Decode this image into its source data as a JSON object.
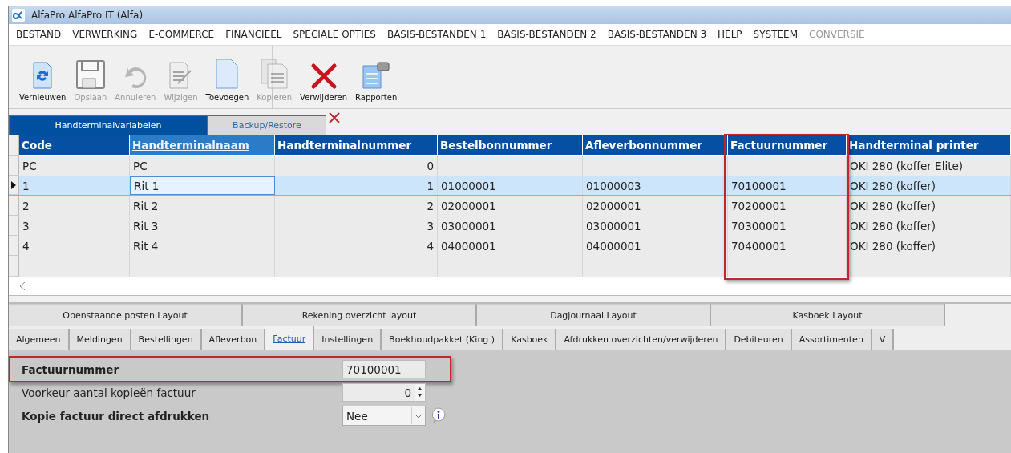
{
  "window": {
    "title": "AlfaPro AlfaPro IT (Alfa)"
  },
  "menu": [
    {
      "label": "BESTAND",
      "disabled": false
    },
    {
      "label": "VERWERKING",
      "disabled": false
    },
    {
      "label": "E-COMMERCE",
      "disabled": false
    },
    {
      "label": "FINANCIEEL",
      "disabled": false
    },
    {
      "label": "SPECIALE OPTIES",
      "disabled": false
    },
    {
      "label": "BASIS-BESTANDEN 1",
      "disabled": false
    },
    {
      "label": "BASIS-BESTANDEN 2",
      "disabled": false
    },
    {
      "label": "BASIS-BESTANDEN 3",
      "disabled": false
    },
    {
      "label": "HELP",
      "disabled": false
    },
    {
      "label": "SYSTEEM",
      "disabled": false
    },
    {
      "label": "CONVERSIE",
      "disabled": true
    }
  ],
  "toolbar": [
    {
      "kind": "refresh",
      "label": "Vernieuwen",
      "disabled": false
    },
    {
      "kind": "save",
      "label": "Opslaan",
      "disabled": true
    },
    {
      "kind": "undo",
      "label": "Annuleren",
      "disabled": true
    },
    {
      "kind": "edit",
      "label": "Wijzigen",
      "disabled": true
    },
    {
      "kind": "new",
      "label": "Toevoegen",
      "disabled": false
    },
    {
      "kind": "copy",
      "label": "Kopieren",
      "disabled": true
    },
    {
      "kind": "delete",
      "label": "Verwijderen",
      "disabled": false
    },
    {
      "kind": "report",
      "label": "Rapporten",
      "disabled": false
    }
  ],
  "tabs": [
    {
      "label": "Handterminalvariabelen",
      "selected": true
    },
    {
      "label": "Backup/Restore",
      "selected": false
    }
  ],
  "table": {
    "columns": [
      {
        "label": "Code",
        "current": false
      },
      {
        "label": "Handterminalnaam",
        "current": true
      },
      {
        "label": "Handterminalnummer",
        "current": false
      },
      {
        "label": "Bestelbonnummer",
        "current": false
      },
      {
        "label": "Afleverbonnummer",
        "current": false
      },
      {
        "label": "Factuurnummer",
        "current": false,
        "highlighted": true
      },
      {
        "label": "Handterminal printer",
        "current": false
      }
    ],
    "rows": [
      {
        "selected": false,
        "cells": [
          "PC",
          "PC",
          "0",
          "",
          "",
          "",
          "OKI 280 (koffer Elite)"
        ]
      },
      {
        "selected": true,
        "cells": [
          "1",
          "Rit 1",
          "1",
          "01000001",
          "01000003",
          "70100001",
          "OKI 280 (koffer)"
        ]
      },
      {
        "selected": false,
        "cells": [
          "2",
          "Rit 2",
          "2",
          "02000001",
          "02000001",
          "70200001",
          "OKI 280 (koffer)"
        ]
      },
      {
        "selected": false,
        "cells": [
          "3",
          "Rit 3",
          "3",
          "03000001",
          "03000001",
          "70300001",
          "OKI 280 (koffer)"
        ]
      },
      {
        "selected": false,
        "cells": [
          "4",
          "Rit 4",
          "4",
          "04000001",
          "04000001",
          "70400001",
          "OKI 280 (koffer)"
        ]
      }
    ]
  },
  "layout_tabs": [
    {
      "label": "Openstaande posten Layout"
    },
    {
      "label": "Rekening overzicht layout"
    },
    {
      "label": "Dagjournaal Layout"
    },
    {
      "label": "Kasboek Layout"
    }
  ],
  "settings_tabs": [
    {
      "label": "Algemeen",
      "selected": false
    },
    {
      "label": "Meldingen",
      "selected": false
    },
    {
      "label": "Bestellingen",
      "selected": false
    },
    {
      "label": "Afleverbon",
      "selected": false
    },
    {
      "label": "Factuur",
      "selected": true
    },
    {
      "label": "Instellingen",
      "selected": false
    },
    {
      "label": "Boekhoudpakket (King )",
      "selected": false
    },
    {
      "label": "Kasboek",
      "selected": false
    },
    {
      "label": "Afdrukken overzichten/verwijderen",
      "selected": false
    },
    {
      "label": "Debiteuren",
      "selected": false
    },
    {
      "label": "Assortimenten",
      "selected": false
    },
    {
      "label": "V",
      "selected": false
    }
  ],
  "form": [
    {
      "label": "Factuurnummer",
      "bold": true,
      "kind": "text",
      "value": "70100001",
      "highlighted": true
    },
    {
      "label": "Voorkeur aantal kopieën factuur",
      "bold": false,
      "kind": "spinner",
      "value": "0"
    },
    {
      "label": "Kopie factuur direct afdrukken",
      "bold": true,
      "kind": "select",
      "value": "Nee",
      "info": true
    }
  ]
}
